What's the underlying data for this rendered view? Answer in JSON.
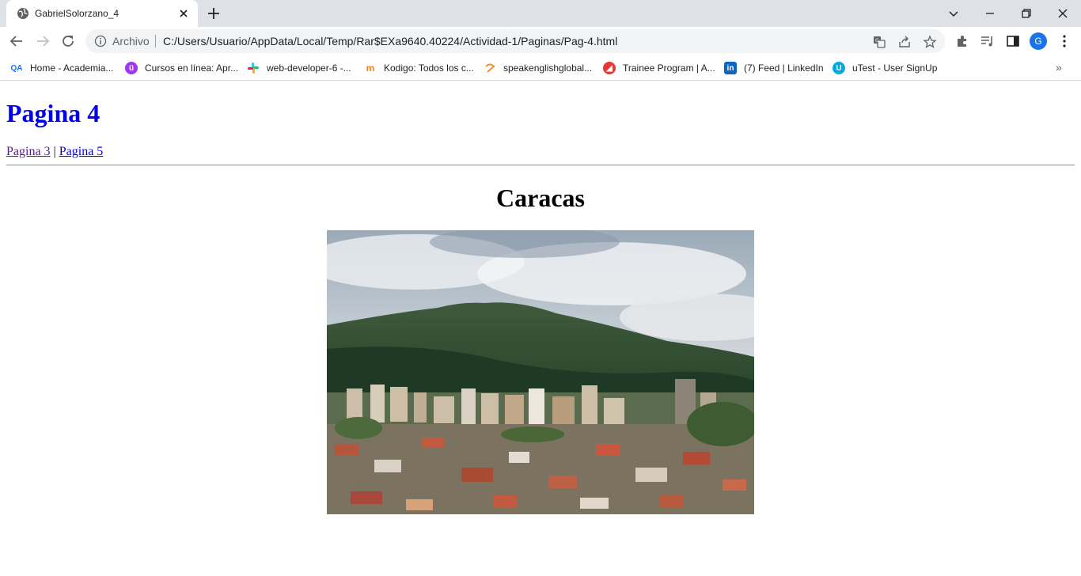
{
  "browser": {
    "tab": {
      "title": "GabrielSolorzano_4"
    },
    "omnibox": {
      "security_label": "Archivo",
      "url": "C:/Users/Usuario/AppData/Local/Temp/Rar$EXa9640.40224/Actividad-1/Paginas/Pag-4.html"
    },
    "profile_initial": "G",
    "bookmarks": [
      {
        "label": "Home - Academia...",
        "icon": "academia-icon",
        "color": "#1a73e8"
      },
      {
        "label": "Cursos en línea: Apr...",
        "icon": "udemy-icon",
        "color": "#a435f0"
      },
      {
        "label": "web-developer-6 -...",
        "icon": "slack-icon",
        "color": "#e01e5a"
      },
      {
        "label": "Kodigo: Todos los c...",
        "icon": "moodle-icon",
        "color": "#f98012"
      },
      {
        "label": "speakenglishglobal...",
        "icon": "speakenglish-icon",
        "color": "#f28c28"
      },
      {
        "label": "Trainee Program | A...",
        "icon": "trainee-icon",
        "color": "#e53935"
      },
      {
        "label": "(7) Feed | LinkedIn",
        "icon": "linkedin-icon",
        "color": "#0a66c2"
      },
      {
        "label": "uTest - User SignUp",
        "icon": "utest-icon",
        "color": "#00a9e0"
      }
    ]
  },
  "page": {
    "heading": "Pagina 4",
    "nav": {
      "prev": "Pagina 3",
      "separator": "|",
      "next": "Pagina 5"
    },
    "city_title": "Caracas",
    "image": {
      "alt": "Caracas"
    }
  }
}
